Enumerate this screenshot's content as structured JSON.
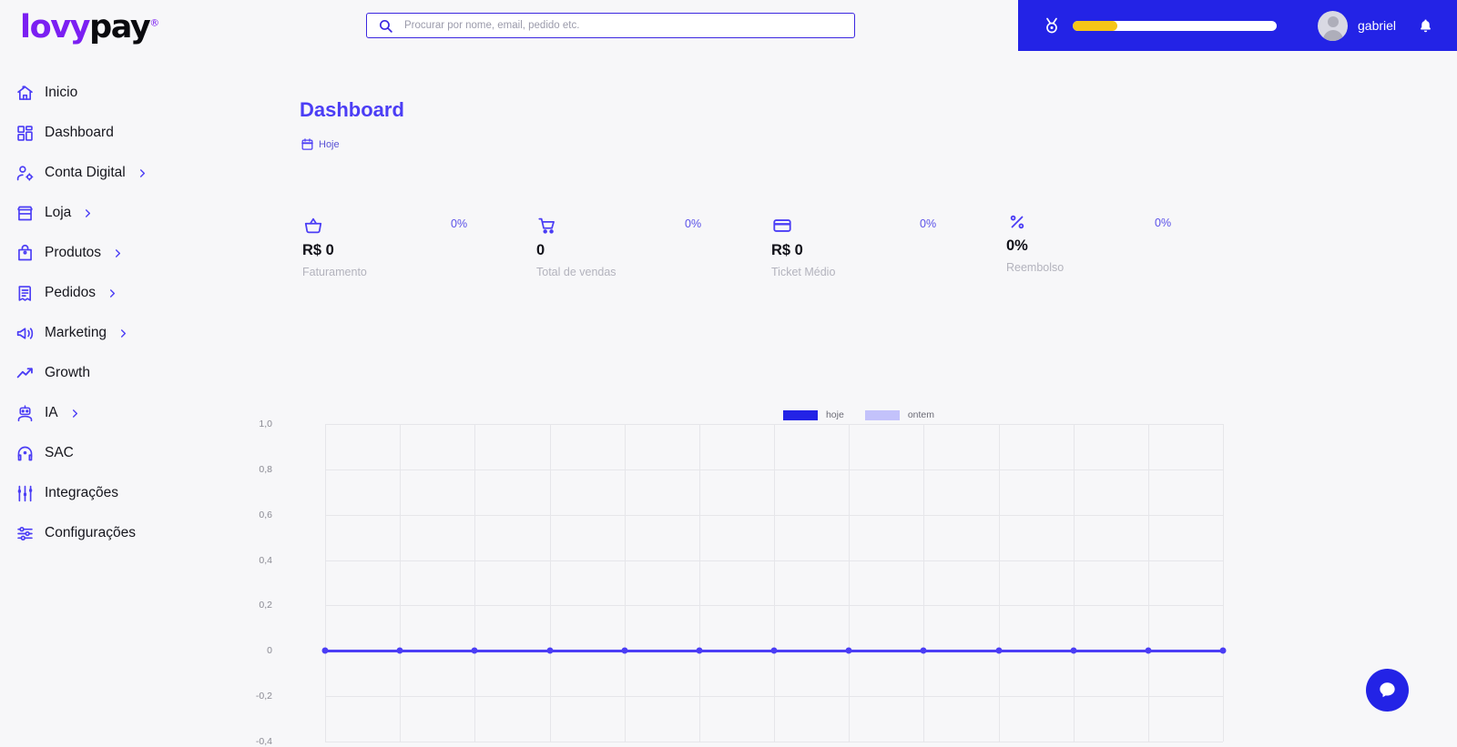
{
  "brand": {
    "name_part1": "lovy",
    "name_part2": "pay",
    "registered": "®"
  },
  "search": {
    "placeholder": "Procurar por nome, email, pedido etc.",
    "value": ""
  },
  "header": {
    "medal_icon": "medal-icon",
    "progress_percent": 22,
    "username": "gabriel",
    "bell_icon": "bell-icon",
    "avatar_icon": "avatar-icon"
  },
  "sidebar": {
    "items": [
      {
        "label": "Inicio",
        "icon": "home-icon",
        "chevron": false
      },
      {
        "label": "Dashboard",
        "icon": "grid-icon",
        "chevron": false
      },
      {
        "label": "Conta Digital",
        "icon": "user-settings-icon",
        "chevron": true
      },
      {
        "label": "Loja",
        "icon": "store-icon",
        "chevron": true
      },
      {
        "label": "Produtos",
        "icon": "bag-icon",
        "chevron": true
      },
      {
        "label": "Pedidos",
        "icon": "receipt-icon",
        "chevron": true
      },
      {
        "label": "Marketing",
        "icon": "megaphone-icon",
        "chevron": true
      },
      {
        "label": "Growth",
        "icon": "trending-up-icon",
        "chevron": false
      },
      {
        "label": "IA",
        "icon": "robot-icon",
        "chevron": true
      },
      {
        "label": "SAC",
        "icon": "headset-icon",
        "chevron": false
      },
      {
        "label": "Integrações",
        "icon": "sliders-icon",
        "chevron": false
      },
      {
        "label": "Configurações",
        "icon": "settings-icon",
        "chevron": false
      }
    ]
  },
  "main": {
    "page_title": "Dashboard",
    "date_filter": {
      "label": "Hoje",
      "icon": "calendar-icon"
    },
    "stats": [
      {
        "icon": "basket-icon",
        "percent": "0%",
        "value": "R$ 0",
        "caption": "Faturamento"
      },
      {
        "icon": "cart-icon",
        "percent": "0%",
        "value": "0",
        "caption": "Total de vendas"
      },
      {
        "icon": "card-icon",
        "percent": "0%",
        "value": "R$ 0",
        "caption": "Ticket Médio"
      },
      {
        "icon": "percent-icon",
        "percent": "0%",
        "value": "0%",
        "caption": "Reembolso"
      }
    ]
  },
  "chat_button": {
    "icon": "chat-bubble-icon"
  },
  "colors": {
    "accent_purple": "#4b3df5",
    "brand_blue": "#2323e6",
    "logo_purple": "#7b1ff2",
    "progress_yellow": "#f5c518",
    "series_hoje": "#2323e6",
    "series_ontem": "#c3c2fb",
    "page_bg": "#f7f7f9"
  },
  "chart_data": {
    "type": "line",
    "title": "",
    "xlabel": "",
    "ylabel": "",
    "ylim": [
      -0.4,
      1.0
    ],
    "yticks": [
      "1,0",
      "0,8",
      "0,6",
      "0,4",
      "0,2",
      "0",
      "-0,2",
      "-0,4"
    ],
    "ytick_values": [
      1.0,
      0.8,
      0.6,
      0.4,
      0.2,
      0,
      -0.2,
      -0.4
    ],
    "grid": true,
    "legend_position": "top-center",
    "legend": [
      "hoje",
      "ontem"
    ],
    "x": [
      0,
      1,
      2,
      3,
      4,
      5,
      6,
      7,
      8,
      9,
      10,
      11,
      12
    ],
    "series": [
      {
        "name": "hoje",
        "color": "#2323e6",
        "values": [
          0,
          0,
          0,
          0,
          0,
          0,
          0,
          0,
          0,
          0,
          0,
          0,
          0
        ]
      },
      {
        "name": "ontem",
        "color": "#c3c2fb",
        "values": [
          0,
          0,
          0,
          0,
          0,
          0,
          0,
          0,
          0,
          0,
          0,
          0,
          0
        ]
      }
    ]
  }
}
